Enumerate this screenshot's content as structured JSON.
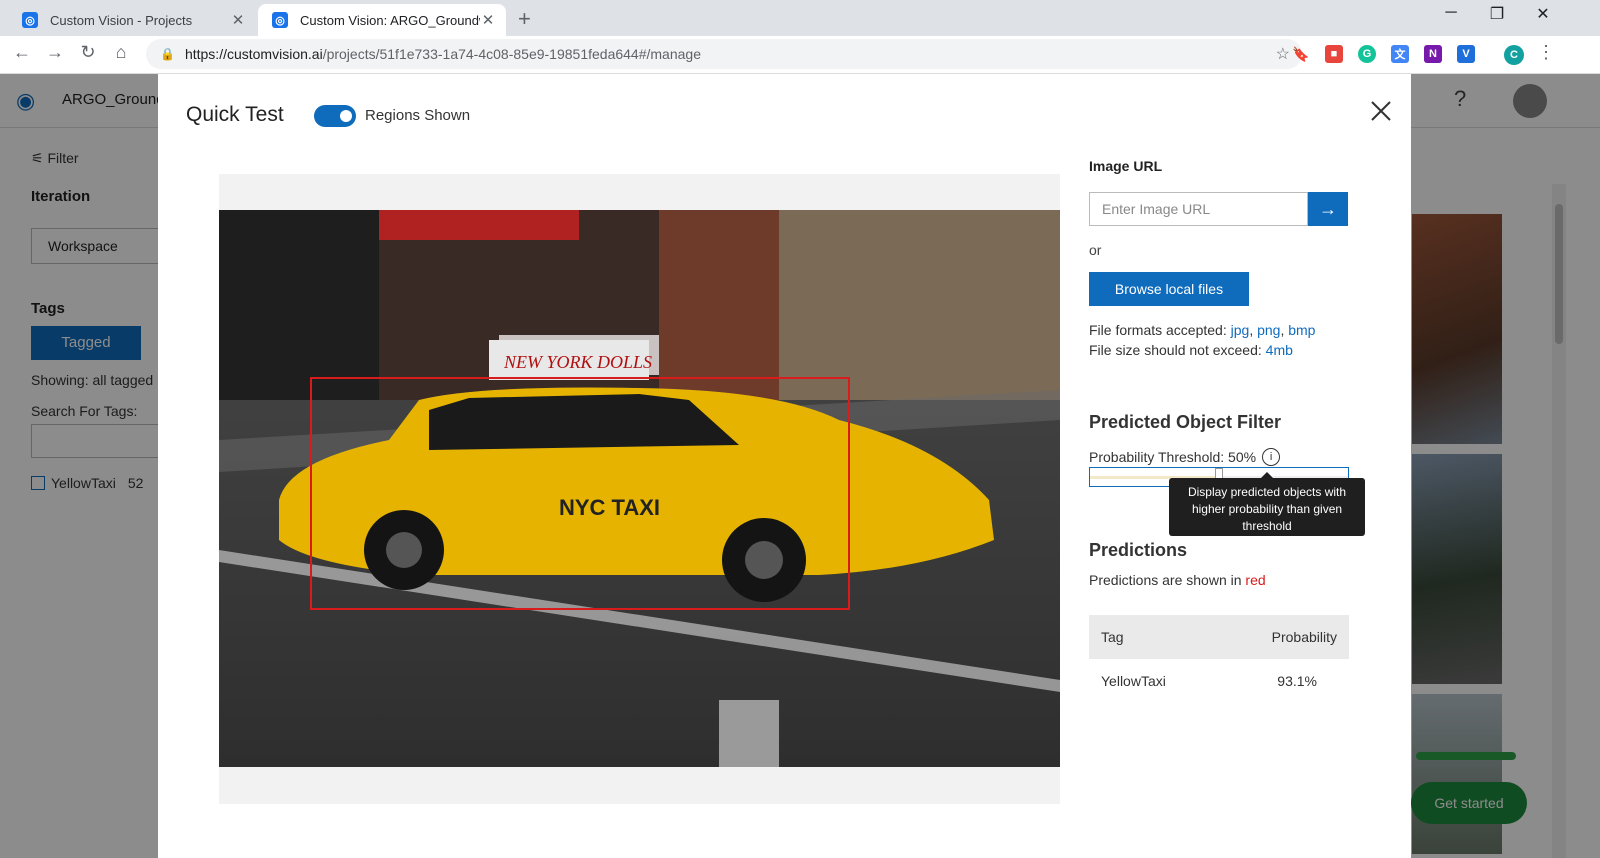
{
  "browser": {
    "tabs": [
      {
        "title": "Custom Vision - Projects",
        "active": false
      },
      {
        "title": "Custom Vision: ARGO_Groundw",
        "active": true
      }
    ],
    "url_host": "https://customvision.ai",
    "url_path": "/projects/51f1e733-1a74-4c08-85e9-19851feda644#/manage"
  },
  "app": {
    "project_name": "ARGO_Ground",
    "help": "?",
    "sidebar": {
      "filter": "Filter",
      "iteration_heading": "Iteration",
      "iteration_value": "Workspace",
      "tags_heading": "Tags",
      "tagged_button": "Tagged",
      "showing": "Showing: all tagged",
      "search_label": "Search For Tags:",
      "tag_name": "YellowTaxi",
      "tag_count": "52"
    },
    "get_started": "Get started"
  },
  "modal": {
    "title": "Quick Test",
    "toggle_label": "Regions Shown",
    "toggle_on": true,
    "image_url_label": "Image URL",
    "image_url_placeholder": "Enter Image URL",
    "or_text": "or",
    "browse_label": "Browse local files",
    "formats_prefix": "File formats accepted:",
    "formats": [
      "jpg",
      "png",
      "bmp"
    ],
    "size_prefix": "File size should not exceed:",
    "size_value": "4mb",
    "filter_heading": "Predicted Object Filter",
    "threshold_label": "Probability Threshold: 50%",
    "threshold_value": 0.5,
    "tooltip": "Display predicted objects with higher probability than given threshold",
    "predictions_heading": "Predictions",
    "predictions_note_prefix": "Predictions are shown in",
    "predictions_note_color": "red",
    "table": {
      "headers": [
        "Tag",
        "Probability"
      ],
      "rows": [
        {
          "tag": "YellowTaxi",
          "probability": "93.1%"
        }
      ]
    }
  },
  "colors": {
    "accent": "#0f6cbd",
    "prediction_box": "#d81b1b"
  }
}
